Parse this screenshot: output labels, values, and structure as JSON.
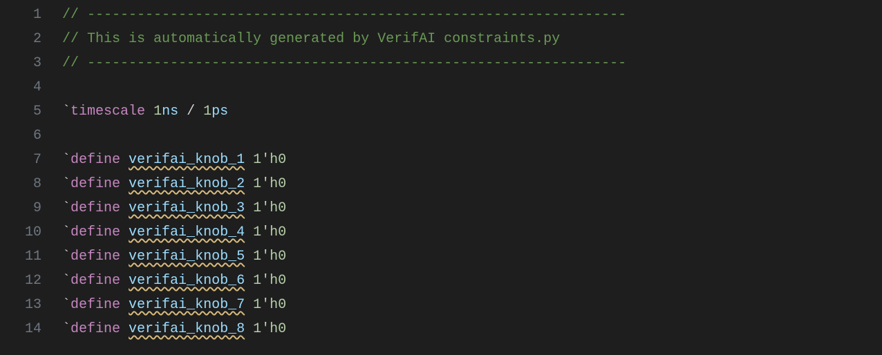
{
  "editor": {
    "lines": [
      {
        "num": "1",
        "tokens": [
          {
            "cls": "tok-comment",
            "text": "// -----------------------------------------------------------------"
          }
        ]
      },
      {
        "num": "2",
        "tokens": [
          {
            "cls": "tok-comment",
            "text": "// This is automatically generated by VerifAI constraints.py"
          }
        ]
      },
      {
        "num": "3",
        "tokens": [
          {
            "cls": "tok-comment",
            "text": "// -----------------------------------------------------------------"
          }
        ]
      },
      {
        "num": "4",
        "tokens": []
      },
      {
        "num": "5",
        "tokens": [
          {
            "cls": "tok-backtick",
            "text": "`"
          },
          {
            "cls": "tok-keyword",
            "text": "timescale"
          },
          {
            "cls": "tok-plain",
            "text": " "
          },
          {
            "cls": "tok-number",
            "text": "1"
          },
          {
            "cls": "tok-ident",
            "text": "ns"
          },
          {
            "cls": "tok-plain",
            "text": " / "
          },
          {
            "cls": "tok-number",
            "text": "1"
          },
          {
            "cls": "tok-ident",
            "text": "ps"
          }
        ]
      },
      {
        "num": "6",
        "tokens": []
      },
      {
        "num": "7",
        "tokens": [
          {
            "cls": "tok-backtick",
            "text": "`"
          },
          {
            "cls": "tok-keyword",
            "text": "define"
          },
          {
            "cls": "tok-plain",
            "text": " "
          },
          {
            "cls": "tok-ident squiggle",
            "text": "verifai_knob_1"
          },
          {
            "cls": "tok-plain",
            "text": " "
          },
          {
            "cls": "tok-number",
            "text": "1'h0"
          }
        ]
      },
      {
        "num": "8",
        "tokens": [
          {
            "cls": "tok-backtick",
            "text": "`"
          },
          {
            "cls": "tok-keyword",
            "text": "define"
          },
          {
            "cls": "tok-plain",
            "text": " "
          },
          {
            "cls": "tok-ident squiggle",
            "text": "verifai_knob_2"
          },
          {
            "cls": "tok-plain",
            "text": " "
          },
          {
            "cls": "tok-number",
            "text": "1'h0"
          }
        ]
      },
      {
        "num": "9",
        "tokens": [
          {
            "cls": "tok-backtick",
            "text": "`"
          },
          {
            "cls": "tok-keyword",
            "text": "define"
          },
          {
            "cls": "tok-plain",
            "text": " "
          },
          {
            "cls": "tok-ident squiggle",
            "text": "verifai_knob_3"
          },
          {
            "cls": "tok-plain",
            "text": " "
          },
          {
            "cls": "tok-number",
            "text": "1'h0"
          }
        ]
      },
      {
        "num": "10",
        "tokens": [
          {
            "cls": "tok-backtick",
            "text": "`"
          },
          {
            "cls": "tok-keyword",
            "text": "define"
          },
          {
            "cls": "tok-plain",
            "text": " "
          },
          {
            "cls": "tok-ident squiggle",
            "text": "verifai_knob_4"
          },
          {
            "cls": "tok-plain",
            "text": " "
          },
          {
            "cls": "tok-number",
            "text": "1'h0"
          }
        ]
      },
      {
        "num": "11",
        "tokens": [
          {
            "cls": "tok-backtick",
            "text": "`"
          },
          {
            "cls": "tok-keyword",
            "text": "define"
          },
          {
            "cls": "tok-plain",
            "text": " "
          },
          {
            "cls": "tok-ident squiggle",
            "text": "verifai_knob_5"
          },
          {
            "cls": "tok-plain",
            "text": " "
          },
          {
            "cls": "tok-number",
            "text": "1'h0"
          }
        ]
      },
      {
        "num": "12",
        "tokens": [
          {
            "cls": "tok-backtick",
            "text": "`"
          },
          {
            "cls": "tok-keyword",
            "text": "define"
          },
          {
            "cls": "tok-plain",
            "text": " "
          },
          {
            "cls": "tok-ident squiggle",
            "text": "verifai_knob_6"
          },
          {
            "cls": "tok-plain",
            "text": " "
          },
          {
            "cls": "tok-number",
            "text": "1'h0"
          }
        ]
      },
      {
        "num": "13",
        "tokens": [
          {
            "cls": "tok-backtick",
            "text": "`"
          },
          {
            "cls": "tok-keyword",
            "text": "define"
          },
          {
            "cls": "tok-plain",
            "text": " "
          },
          {
            "cls": "tok-ident squiggle",
            "text": "verifai_knob_7"
          },
          {
            "cls": "tok-plain",
            "text": " "
          },
          {
            "cls": "tok-number",
            "text": "1'h0"
          }
        ]
      },
      {
        "num": "14",
        "tokens": [
          {
            "cls": "tok-backtick",
            "text": "`"
          },
          {
            "cls": "tok-keyword",
            "text": "define"
          },
          {
            "cls": "tok-plain",
            "text": " "
          },
          {
            "cls": "tok-ident squiggle",
            "text": "verifai_knob_8"
          },
          {
            "cls": "tok-plain",
            "text": " "
          },
          {
            "cls": "tok-number",
            "text": "1'h0"
          }
        ]
      }
    ]
  }
}
